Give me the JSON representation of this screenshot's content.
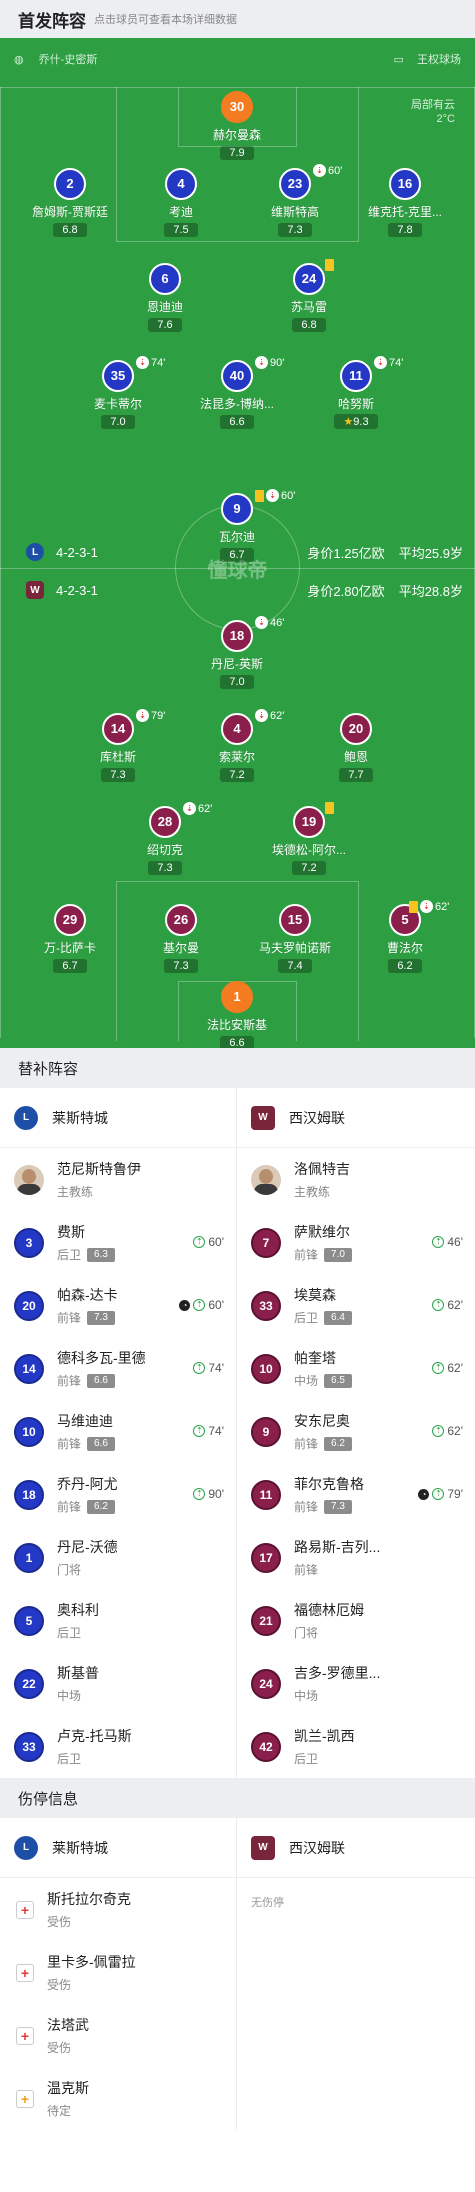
{
  "header": {
    "title": "首发阵容",
    "subtitle": "点击球员可查看本场详细数据"
  },
  "pitch": {
    "referee": "乔什-史密斯",
    "stadium": "王权球场",
    "weather": "局部有云",
    "temp": "2°C",
    "watermark": "懂球帝"
  },
  "formations": {
    "home": {
      "shape": "4-2-3-1",
      "value": "身价1.25亿欧",
      "age": "平均25.9岁"
    },
    "away": {
      "shape": "4-2-3-1",
      "value": "身价2.80亿欧",
      "age": "平均28.8岁"
    }
  },
  "home_lineup": [
    {
      "num": "30",
      "name": "赫尔曼森",
      "rating": "7.9"
    },
    {
      "num": "2",
      "name": "詹姆斯-贾斯廷",
      "rating": "6.8"
    },
    {
      "num": "4",
      "name": "考迪",
      "rating": "7.5"
    },
    {
      "num": "23",
      "name": "维斯特高",
      "rating": "7.3",
      "min": "60'"
    },
    {
      "num": "16",
      "name": "维克托-克里...",
      "rating": "7.8"
    },
    {
      "num": "6",
      "name": "恩迪迪",
      "rating": "7.6"
    },
    {
      "num": "24",
      "name": "苏马雷",
      "rating": "6.8"
    },
    {
      "num": "35",
      "name": "麦卡蒂尔",
      "rating": "7.0",
      "min": "74'"
    },
    {
      "num": "40",
      "name": "法昆多-博纳...",
      "rating": "6.6",
      "min": "90'"
    },
    {
      "num": "11",
      "name": "哈努斯",
      "rating": "9.3",
      "min": "74'"
    },
    {
      "num": "9",
      "name": "瓦尔迪",
      "rating": "6.7",
      "min": "60'"
    }
  ],
  "away_lineup": [
    {
      "num": "18",
      "name": "丹尼-英斯",
      "rating": "7.0",
      "min": "46'"
    },
    {
      "num": "14",
      "name": "库杜斯",
      "rating": "7.3",
      "min": "79'"
    },
    {
      "num": "4",
      "name": "索莱尔",
      "rating": "7.2",
      "min": "62'"
    },
    {
      "num": "20",
      "name": "鲍恩",
      "rating": "7.7"
    },
    {
      "num": "28",
      "name": "绍切克",
      "rating": "7.3",
      "min": "62'"
    },
    {
      "num": "19",
      "name": "埃德松-阿尔...",
      "rating": "7.2"
    },
    {
      "num": "29",
      "name": "万-比萨卡",
      "rating": "6.7"
    },
    {
      "num": "26",
      "name": "基尔曼",
      "rating": "7.3"
    },
    {
      "num": "15",
      "name": "马夫罗帕诺斯",
      "rating": "7.4"
    },
    {
      "num": "5",
      "name": "曹法尔",
      "rating": "6.2",
      "min": "62'"
    },
    {
      "num": "1",
      "name": "法比安斯基",
      "rating": "6.6"
    }
  ],
  "subs_section": {
    "title": "替补阵容"
  },
  "teams": {
    "home": "莱斯特城",
    "away": "西汉姆联"
  },
  "coaches": {
    "home": {
      "name": "范尼斯特鲁伊",
      "role": "主教练"
    },
    "away": {
      "name": "洛佩特吉",
      "role": "主教练"
    }
  },
  "home_subs": [
    {
      "num": "3",
      "name": "费斯",
      "pos": "后卫",
      "rating": "6.3",
      "min": "60'"
    },
    {
      "num": "20",
      "name": "帕森-达卡",
      "pos": "前锋",
      "rating": "7.3",
      "min": "60'"
    },
    {
      "num": "14",
      "name": "德科多瓦-里德",
      "pos": "前锋",
      "rating": "6.6",
      "min": "74'"
    },
    {
      "num": "10",
      "name": "马维迪迪",
      "pos": "前锋",
      "rating": "6.6",
      "min": "74'"
    },
    {
      "num": "18",
      "name": "乔丹-阿尤",
      "pos": "前锋",
      "rating": "6.2",
      "min": "90'"
    },
    {
      "num": "1",
      "name": "丹尼-沃德",
      "pos": "门将"
    },
    {
      "num": "5",
      "name": "奥科利",
      "pos": "后卫"
    },
    {
      "num": "22",
      "name": "斯基普",
      "pos": "中场"
    },
    {
      "num": "33",
      "name": "卢克-托马斯",
      "pos": "后卫"
    }
  ],
  "away_subs": [
    {
      "num": "7",
      "name": "萨默维尔",
      "pos": "前锋",
      "rating": "7.0",
      "min": "46'"
    },
    {
      "num": "33",
      "name": "埃莫森",
      "pos": "后卫",
      "rating": "6.4",
      "min": "62'"
    },
    {
      "num": "10",
      "name": "帕奎塔",
      "pos": "中场",
      "rating": "6.5",
      "min": "62'"
    },
    {
      "num": "9",
      "name": "安东尼奥",
      "pos": "前锋",
      "rating": "6.2",
      "min": "62'"
    },
    {
      "num": "11",
      "name": "菲尔克鲁格",
      "pos": "前锋",
      "rating": "7.3",
      "min": "79'"
    },
    {
      "num": "17",
      "name": "路易斯-吉列...",
      "pos": "前锋"
    },
    {
      "num": "21",
      "name": "福德林厄姆",
      "pos": "门将"
    },
    {
      "num": "24",
      "name": "吉多-罗德里...",
      "pos": "中场"
    },
    {
      "num": "42",
      "name": "凯兰-凯西",
      "pos": "后卫"
    }
  ],
  "injury_section": {
    "title": "伤停信息",
    "none": "无伤停"
  },
  "home_injuries": [
    {
      "name": "斯托拉尔奇克",
      "status": "受伤"
    },
    {
      "name": "里卡多-佩雷拉",
      "status": "受伤"
    },
    {
      "name": "法塔武",
      "status": "受伤"
    },
    {
      "name": "温克斯",
      "status": "待定"
    }
  ],
  "colors": {
    "pitch": "#2e9e42",
    "home": "#2438c6",
    "away": "#8a1f4c",
    "gk_home": "#f47b20",
    "gk_away": "#f47b20",
    "card": "#f6c321"
  }
}
